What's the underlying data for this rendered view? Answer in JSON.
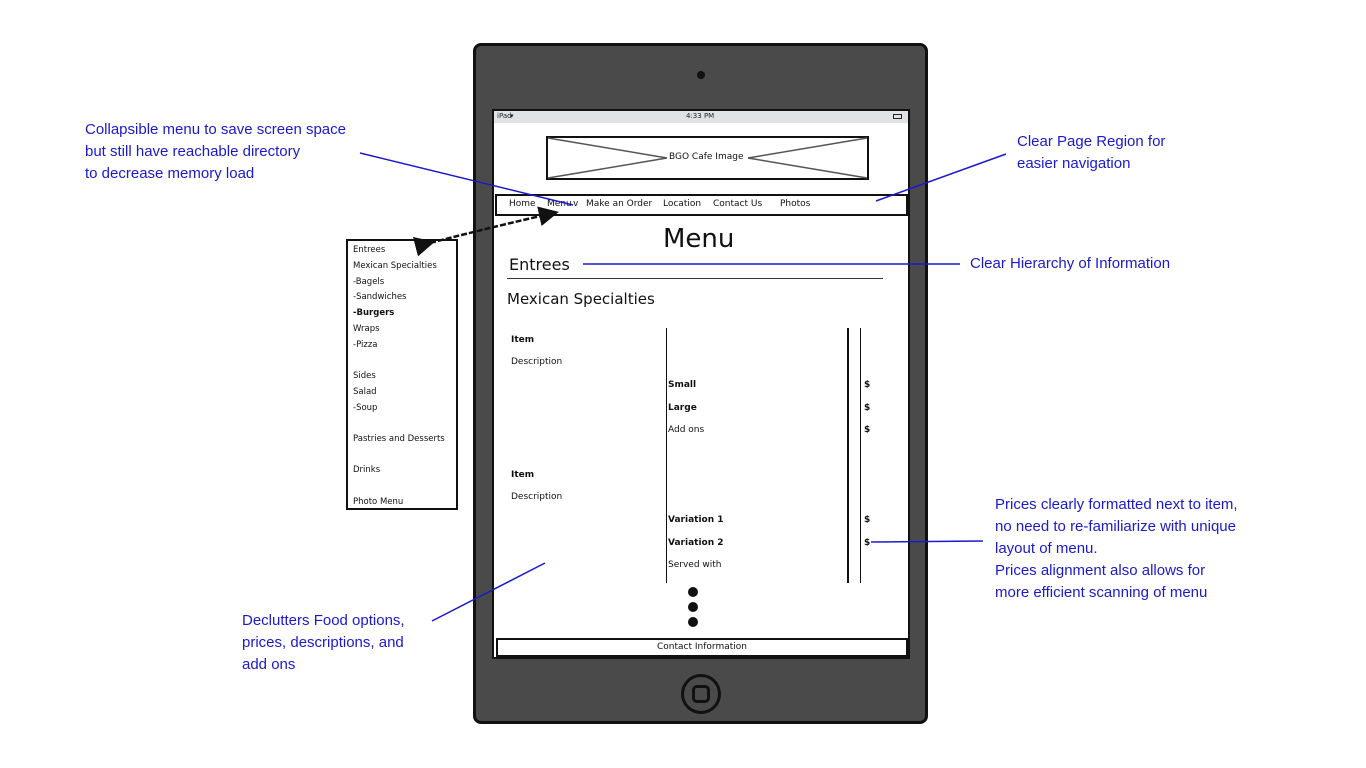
{
  "status_bar": {
    "device": "iPad",
    "time": "4:33 PM"
  },
  "hero_image_label": "BGO Cafe Image",
  "nav": [
    "Home",
    "Menu",
    "Make an Order",
    "Location",
    "Contact Us",
    "Photos"
  ],
  "nav_caret": "v",
  "page_title": "Menu",
  "section_heading": "Entrees",
  "subsection_heading": "Mexican Specialties",
  "item_block_1": {
    "item": "Item",
    "description": "Description",
    "options": [
      "Small",
      "Large",
      "Add ons"
    ],
    "price_symbol": "$"
  },
  "item_block_2": {
    "item": "Item",
    "description": "Description",
    "options": [
      "Variation 1",
      "Variation 2",
      "Served with"
    ],
    "price_symbol": "$"
  },
  "footer": "Contact Information",
  "side_menu": [
    "Entrees",
    "Mexican Specialties",
    "-Bagels",
    "-Sandwiches",
    "-Burgers",
    " Wraps",
    "-Pizza",
    "Sides",
    " Salad",
    "-Soup",
    "Pastries and Desserts",
    "Drinks",
    "Photo Menu"
  ],
  "annotations": {
    "collapsible": [
      "Collapsible menu to save screen space",
      "but still have reachable directory",
      "to decrease memory load"
    ],
    "page_region": [
      "Clear Page Region for",
      "easier navigation"
    ],
    "hierarchy": [
      "Clear Hierarchy of Information"
    ],
    "prices": [
      "Prices clearly formatted next to item,",
      "no need to re-familiarize with unique",
      "layout of menu.",
      "Prices alignment also allows for",
      "more efficient scanning of menu"
    ],
    "declutters": [
      "Declutters Food options,",
      "prices, descriptions, and",
      "add ons"
    ]
  },
  "colors": {
    "annotation": "#1a1acc",
    "device": "#4a4a4a",
    "status_bar": "#dfe3e6"
  }
}
